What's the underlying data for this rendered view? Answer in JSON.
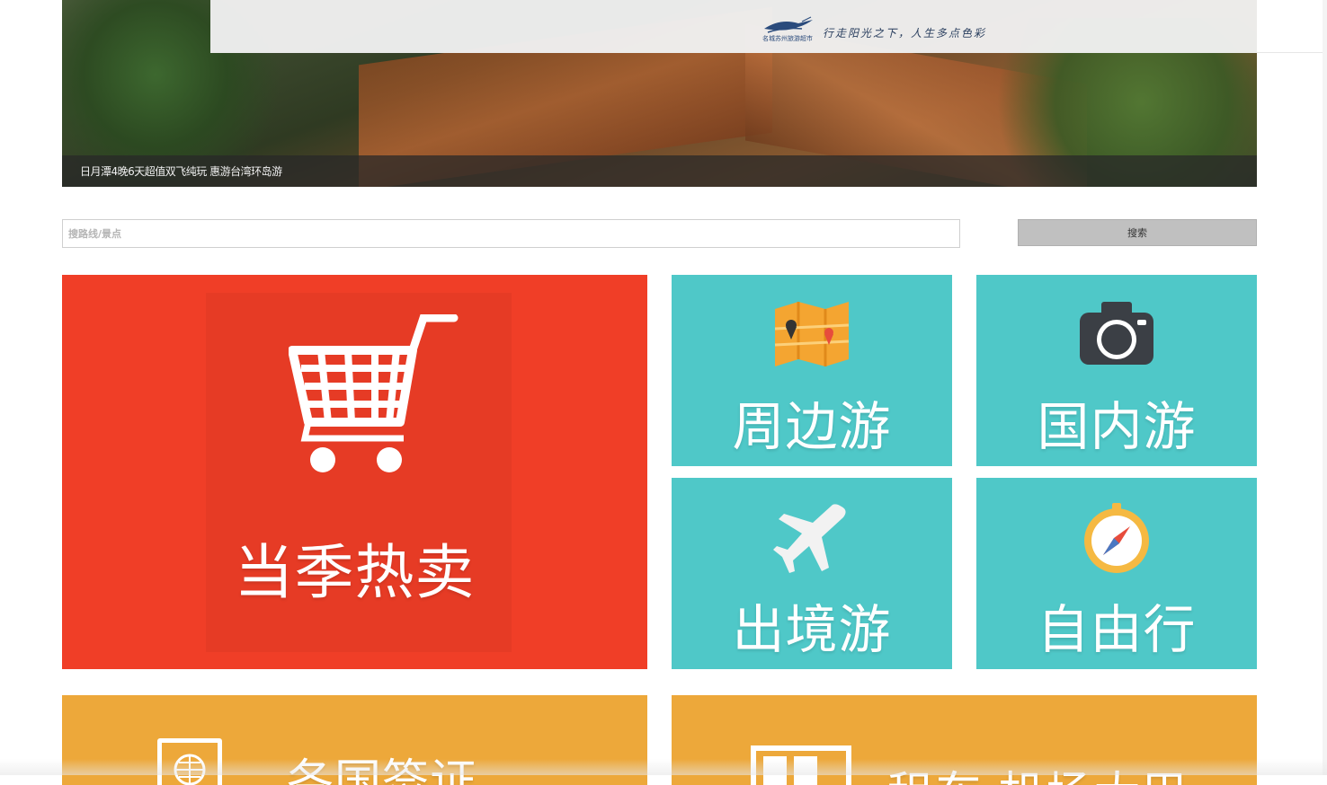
{
  "header": {
    "logo_text": "名城苏州旅游超市",
    "slogan": "行走阳光之下，人生多点色彩"
  },
  "banner": {
    "caption": "日月潭4晚6天超值双飞纯玩 惠游台湾环岛游"
  },
  "search": {
    "placeholder": "搜路线/景点",
    "button_label": "搜索"
  },
  "tiles": {
    "hot": {
      "label": "当季热卖",
      "icon": "shopping-cart-icon"
    },
    "nearby": {
      "label": "周边游",
      "icon": "map-icon"
    },
    "domestic": {
      "label": "国内游",
      "icon": "camera-icon"
    },
    "outbound": {
      "label": "出境游",
      "icon": "airplane-icon"
    },
    "free": {
      "label": "自由行",
      "icon": "compass-icon"
    },
    "visa": {
      "label": "各国签证",
      "icon": "passport-icon"
    },
    "car": {
      "label": "租车·机场大巴",
      "icon": "bus-icon"
    }
  },
  "colors": {
    "hot_red": "#f03e27",
    "teal": "#4fc8c8",
    "orange": "#eda83a",
    "search_button": "#c0c0c0"
  }
}
